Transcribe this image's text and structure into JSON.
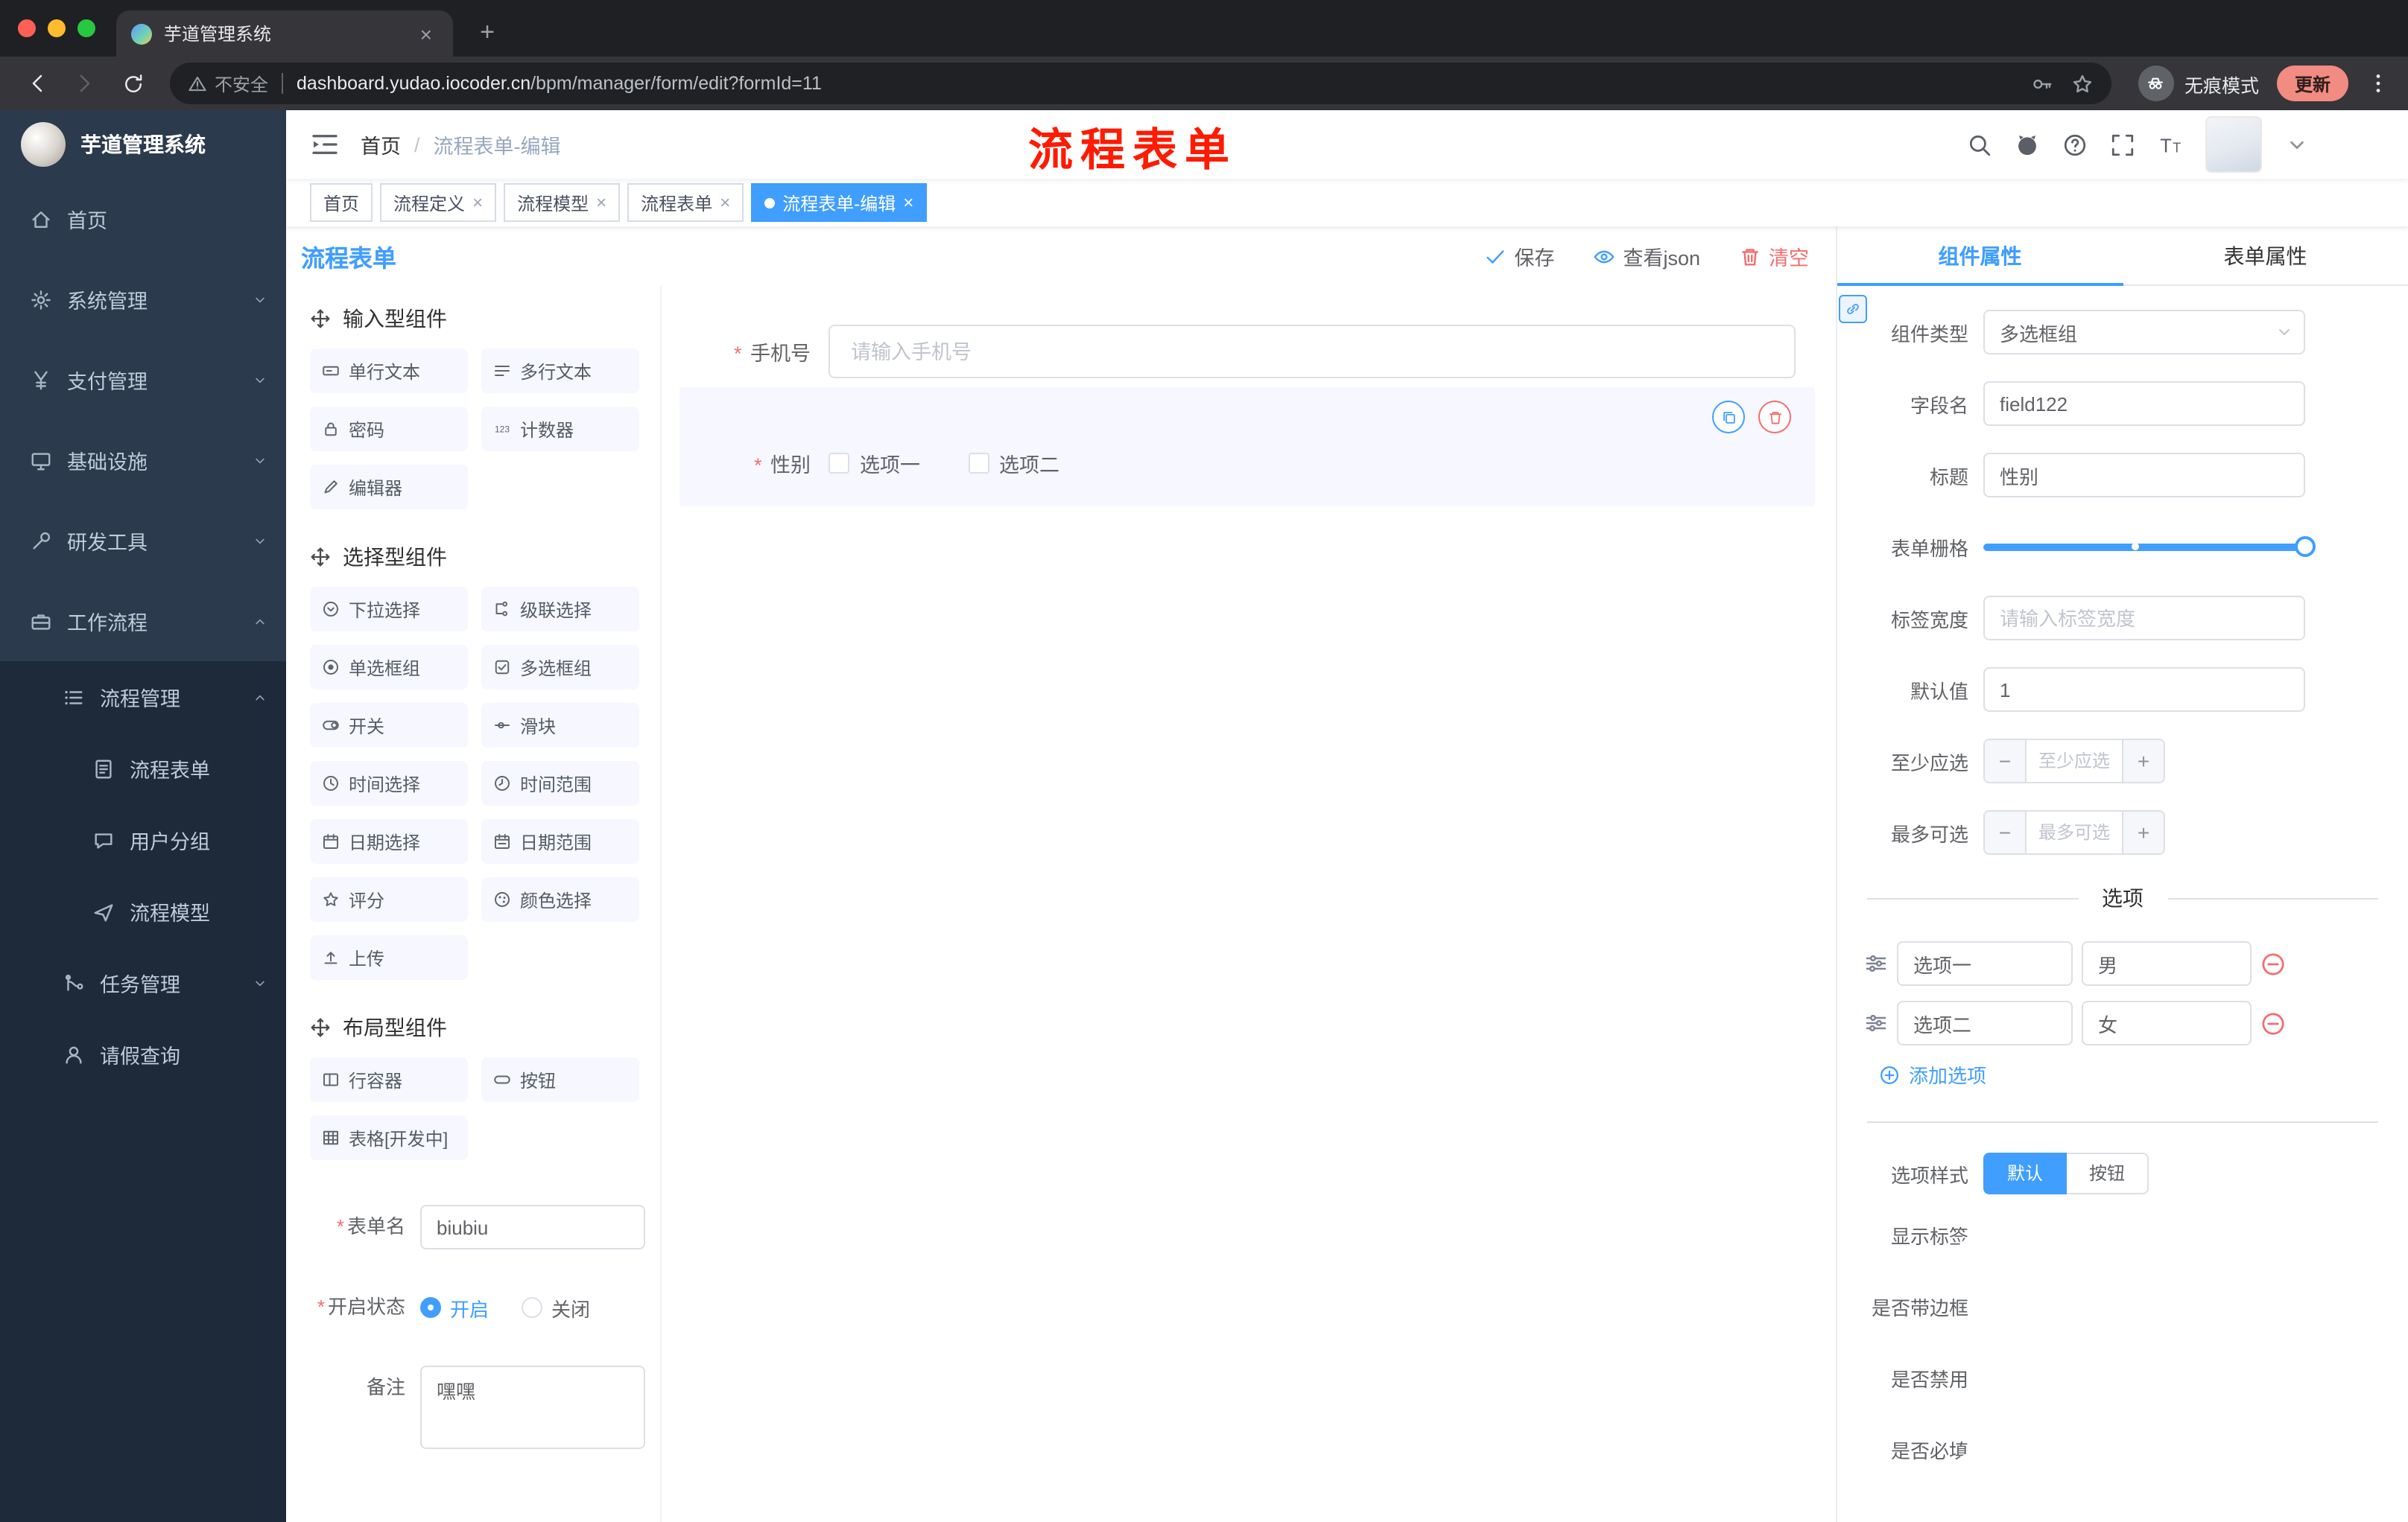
{
  "colors": {
    "accent": "#409eff",
    "danger": "#f56c6c",
    "sidebar_bg": "#2b3a4d",
    "sidebar_submenu_bg": "#1e2a3a",
    "annotation": "#ff1a00"
  },
  "browser": {
    "tab_title": "芋道管理系统",
    "security_label": "不安全",
    "url_domain": "dashboard.yudao.iocoder.cn",
    "url_path": "/bpm/manager/form/edit?formId=11",
    "incognito_label": "无痕模式",
    "update_label": "更新"
  },
  "sidebar": {
    "logo_title": "芋道管理系统",
    "items": [
      "首页",
      "系统管理",
      "支付管理",
      "基础设施",
      "研发工具",
      "工作流程",
      "流程管理",
      "流程表单",
      "用户分组",
      "流程模型",
      "任务管理",
      "请假查询"
    ]
  },
  "header": {
    "breadcrumb_home": "首页",
    "breadcrumb_current": "流程表单-编辑",
    "annotation": "流程表单"
  },
  "tags": {
    "items": [
      "首页",
      "流程定义",
      "流程模型",
      "流程表单",
      "流程表单-编辑"
    ]
  },
  "designer": {
    "title": "流程表单",
    "save": "保存",
    "view_json": "查看json",
    "clear": "清空"
  },
  "palette": {
    "group_input": "输入型组件",
    "group_select": "选择型组件",
    "group_layout": "布局型组件",
    "input_items": [
      "单行文本",
      "多行文本",
      "密码",
      "计数器",
      "编辑器"
    ],
    "select_items": [
      "下拉选择",
      "级联选择",
      "单选框组",
      "多选框组",
      "开关",
      "滑块",
      "时间选择",
      "时间范围",
      "日期选择",
      "日期范围",
      "评分",
      "颜色选择",
      "上传"
    ],
    "layout_items": [
      "行容器",
      "按钮",
      "表格[开发中]"
    ]
  },
  "form_meta": {
    "name_label": "表单名",
    "name_value": "biubiu",
    "status_label": "开启状态",
    "status_on": "开启",
    "status_off": "关闭",
    "remark_label": "备注",
    "remark_value": "嘿嘿"
  },
  "canvas": {
    "phone_label": "手机号",
    "phone_placeholder": "请输入手机号",
    "gender_label": "性别",
    "option1": "选项一",
    "option2": "选项二"
  },
  "props": {
    "tab_component": "组件属性",
    "tab_form": "表单属性",
    "type_label": "组件类型",
    "type_value": "多选框组",
    "field_label": "字段名",
    "field_value": "field122",
    "title_label": "标题",
    "title_value": "性别",
    "grid_label": "表单栅格",
    "label_width_label": "标签宽度",
    "label_width_placeholder": "请输入标签宽度",
    "default_label": "默认值",
    "default_value": "1",
    "min_label": "至少应选",
    "min_placeholder": "至少应选",
    "max_label": "最多可选",
    "max_placeholder": "最多可选",
    "options_divider": "选项",
    "opt1_label": "选项一",
    "opt1_value": "男",
    "opt2_label": "选项二",
    "opt2_value": "女",
    "add_option": "添加选项",
    "style_label": "选项样式",
    "style_default": "默认",
    "style_button": "按钮",
    "show_label": "显示标签",
    "border_label": "是否带边框",
    "disabled_label": "是否禁用",
    "required_label": "是否必填"
  }
}
